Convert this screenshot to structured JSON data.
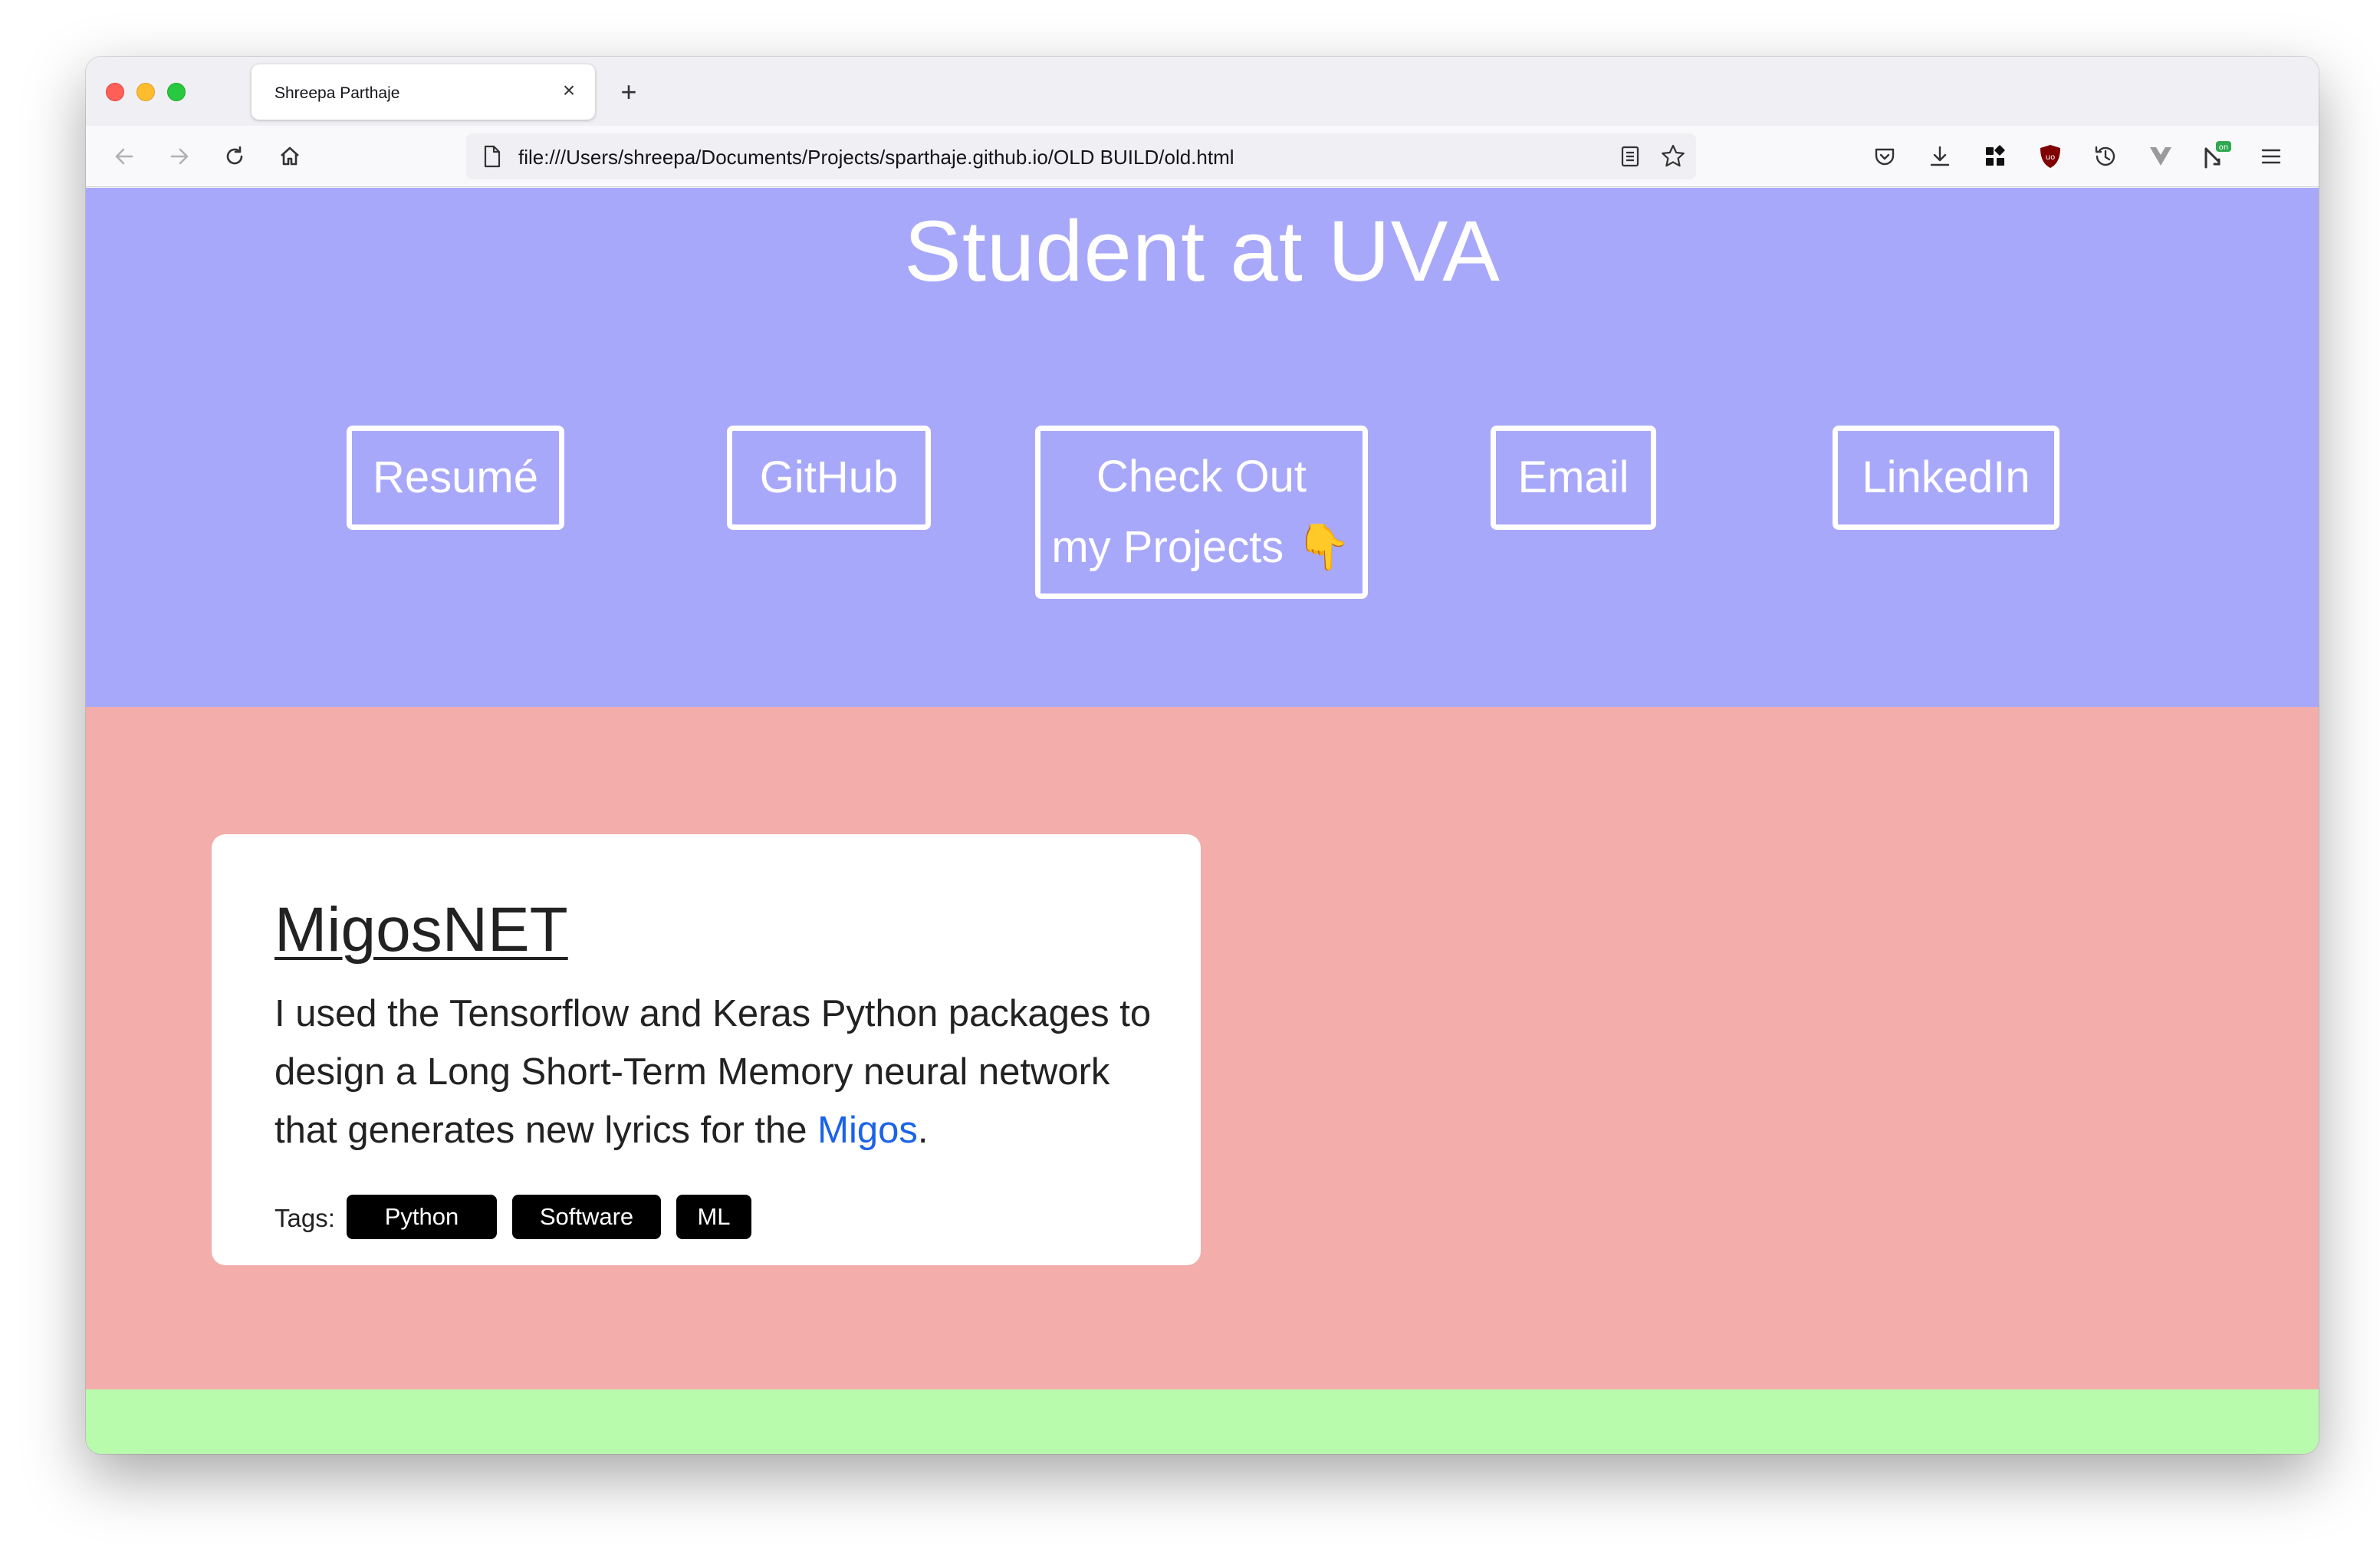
{
  "browser": {
    "tab_title": "Shreepa Parthaje",
    "tab_close": "×",
    "new_tab": "+",
    "url": "file:///Users/shreepa/Documents/Projects/sparthaje.github.io/OLD BUILD/old.html"
  },
  "hero": {
    "title": "Student at UVA",
    "buttons": {
      "resume": "Resumé",
      "github": "GitHub",
      "projects_line1": "Check Out",
      "projects_line2": "my Projects 👇",
      "email": "Email",
      "linkedin": "LinkedIn"
    }
  },
  "project": {
    "title": "MigosNET",
    "description_before": "I used the Tensorflow and Keras Python packages to design a Long Short-Term Memory neural network that generates new lyrics for the ",
    "description_link": "Migos",
    "description_after": ".",
    "tags_label": "Tags:",
    "tags": [
      "Python",
      "Software",
      "ML"
    ]
  },
  "colors": {
    "hero_bg": "#a8a8fa",
    "projects_bg": "#f3adab",
    "footer_bg": "#b9fbad",
    "link": "#1b63e8"
  }
}
